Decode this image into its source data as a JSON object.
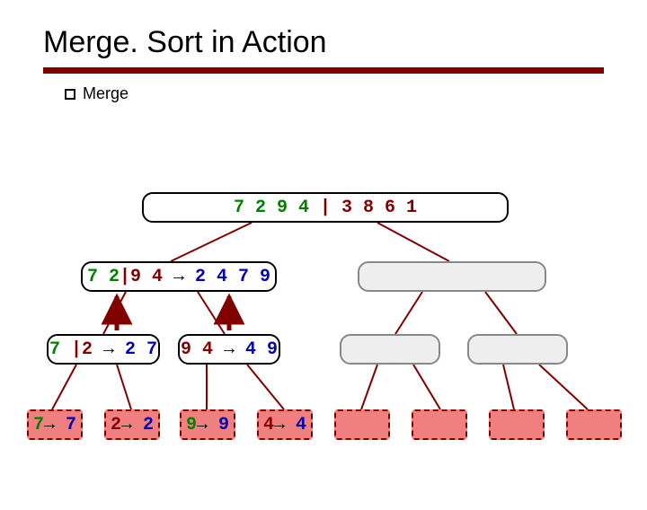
{
  "title": "Merge. Sort in Action",
  "bullet": "Merge",
  "tree": {
    "root": {
      "green": "7 2 9 4",
      "sep": " | ",
      "maroon": "3 8 6 1"
    },
    "l1_left": {
      "green": "7 2",
      "sep": "|",
      "maroon": "9 4",
      "arrow": " → ",
      "blue": "2 4 7 9"
    },
    "l2_a": {
      "green": "7",
      "sep": " |",
      "maroon": "2",
      "arrow": " → ",
      "blue": "2 7"
    },
    "l2_b": {
      "maroon": "9 4",
      "arrow": " → ",
      "blue": "4 9"
    },
    "leaf_a": {
      "green": "7",
      "arrow": "→ ",
      "blue": "7"
    },
    "leaf_b": {
      "maroon": "2",
      "arrow": "→ ",
      "blue": "2"
    },
    "leaf_c": {
      "green": "9",
      "arrow": "→ ",
      "blue": "9"
    },
    "leaf_d": {
      "maroon": "4",
      "arrow": "→ ",
      "blue": "4"
    }
  }
}
